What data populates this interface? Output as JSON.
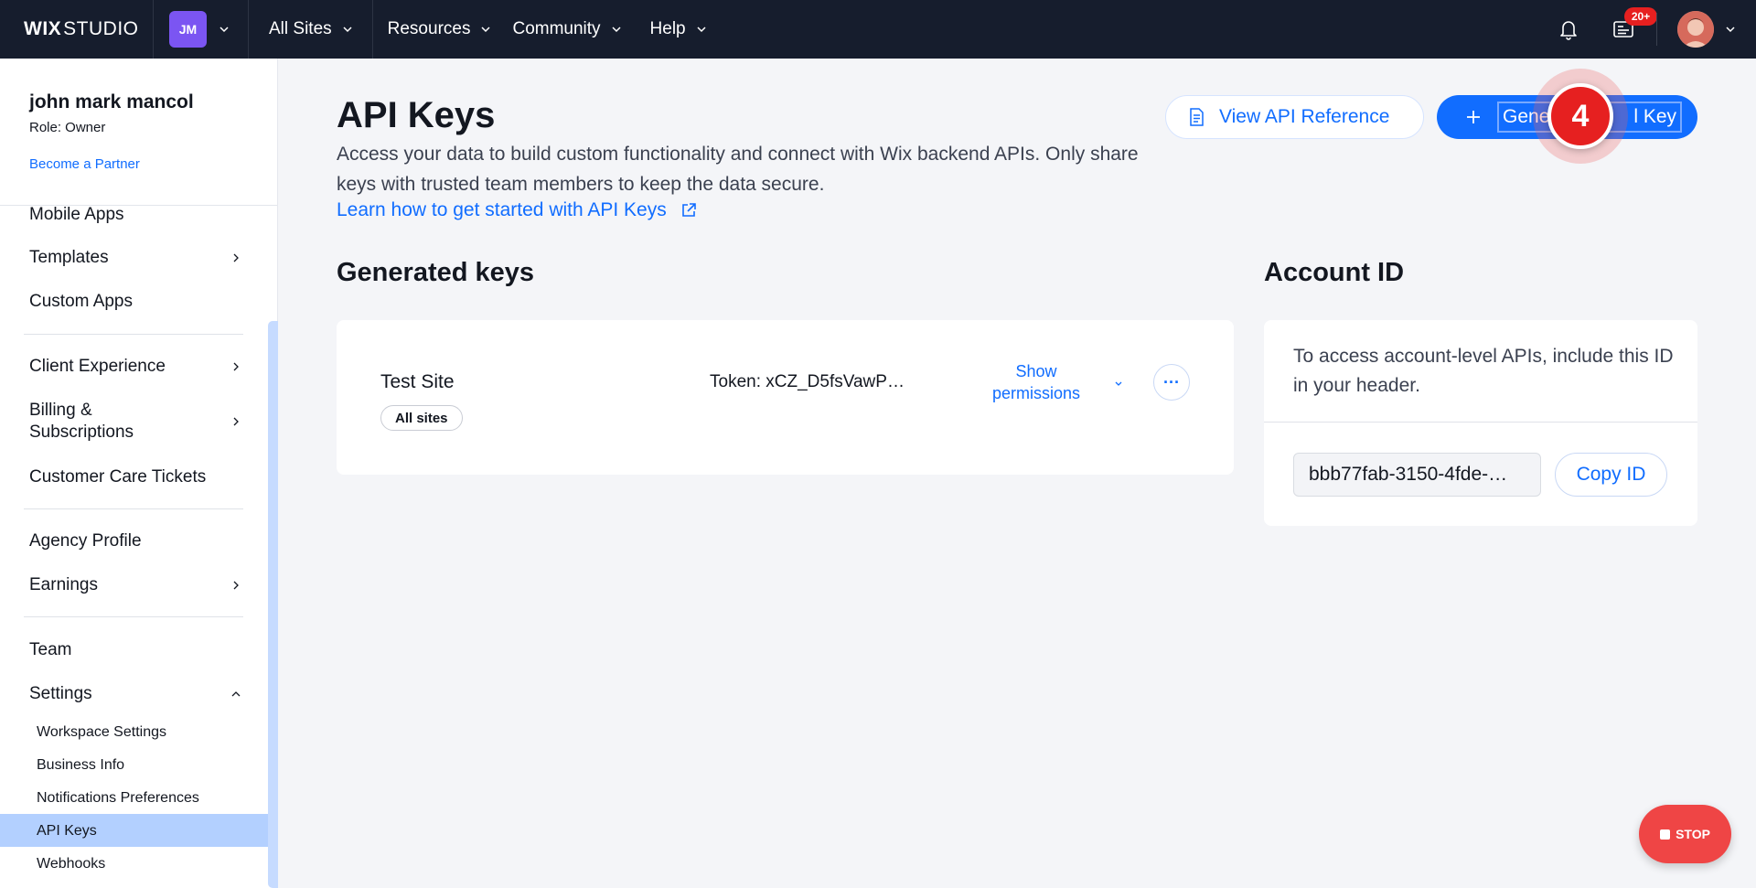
{
  "topbar": {
    "logo_bold": "WIX",
    "logo_light": "STUDIO",
    "workspace_initials": "JM",
    "nav": {
      "all_sites": "All Sites",
      "resources": "Resources",
      "community": "Community",
      "help": "Help"
    },
    "notification_badge": "20+"
  },
  "sidebar": {
    "profile": {
      "name": "john mark mancol",
      "role": "Role: Owner",
      "partner_link": "Become a Partner"
    },
    "items": {
      "mobile_apps": "Mobile Apps",
      "templates": "Templates",
      "custom_apps": "Custom Apps",
      "client_experience": "Client Experience",
      "billing_1": "Billing &",
      "billing_2": "Subscriptions",
      "customer_care": "Customer Care Tickets",
      "agency_profile": "Agency Profile",
      "earnings": "Earnings",
      "team": "Team",
      "settings": "Settings"
    },
    "settings_sub": {
      "workspace": "Workspace Settings",
      "business_info": "Business Info",
      "notifications": "Notifications Preferences",
      "api_keys": "API Keys",
      "webhooks": "Webhooks"
    }
  },
  "main": {
    "title": "API Keys",
    "description": "Access your data to build custom functionality and connect with Wix backend APIs. Only share keys with trusted team members to keep the data secure.",
    "learn_link": "Learn how to get started with API Keys",
    "view_ref_button": "View API Reference",
    "generate_button_visible": "Gene",
    "generate_button_tail": "l Key",
    "step_number": "4",
    "generated_keys": {
      "title": "Generated keys",
      "key": {
        "name": "Test Site",
        "tag": "All sites",
        "token": "Token: xCZ_D5fsVawP…",
        "show_permissions_1": "Show",
        "show_permissions_2": "permissions",
        "more": "···"
      }
    },
    "account": {
      "title": "Account ID",
      "description": "To access account-level APIs, include this ID in your header.",
      "id_value": "bbb77fab-3150-4fde-…",
      "copy_button": "Copy ID"
    }
  },
  "stop_button": "STOP",
  "colors": {
    "topbar_bg": "#161d2d",
    "accent": "#116dff",
    "badge_red": "#e62020",
    "workspace_purple": "#7b55f2"
  }
}
